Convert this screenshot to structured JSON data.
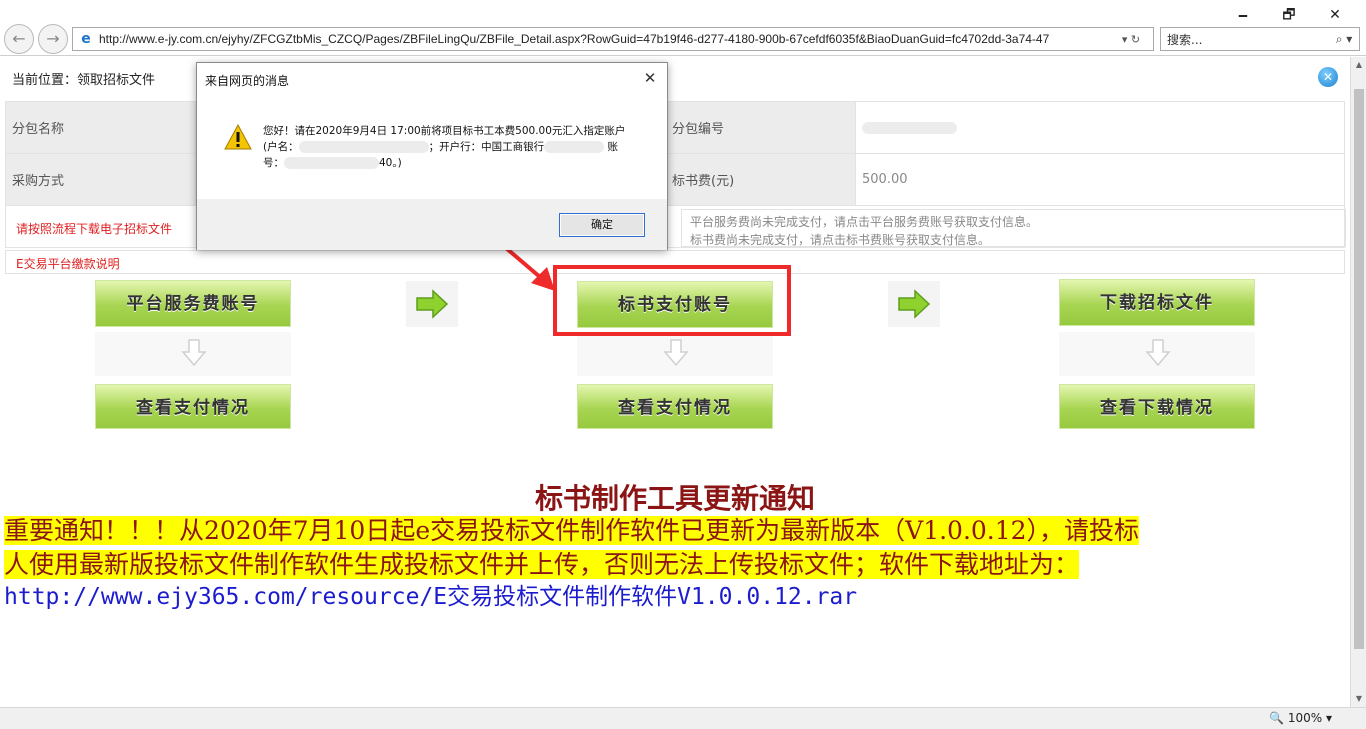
{
  "browser": {
    "window_controls": [
      "🗕",
      "🗗",
      "✕"
    ],
    "back_icon": "back-arrow-icon",
    "forward_icon": "forward-arrow-icon",
    "address": "http://www.e-jy.com.cn/ejyhy/ZFCGZtbMis_CZCQ/Pages/ZBFileLingQu/ZBFile_Detail.aspx?RowGuid=47b19f46-d277-4180-900b-67cefdf6035f&BiaoDuanGuid=fc4702dd-3a74-47",
    "address_controls": "▾ ↻",
    "search_placeholder": "搜索...",
    "search_icon": "⌕ ▾"
  },
  "page": {
    "breadcrumb": "当前位置：领取招标文件",
    "close_glyph": "✕",
    "fields": {
      "package_name_label": "分包名称",
      "package_no_label": "分包编号",
      "purchase_method_label": "采购方式",
      "doc_fee_label": "标书费(元)",
      "doc_fee_value": "500.00"
    },
    "notice_left": "请按照流程下载电子招标文件",
    "notice_right_1": "平台服务费尚未完成支付，请点击平台服务费账号获取支付信息。",
    "notice_right_2": "标书费尚未完成支付，请点击标书费账号获取支付信息。",
    "payment_note": "E交易平台缴款说明",
    "buttons": {
      "platform_fee_account": "平台服务费账号",
      "doc_pay_account": "标书支付账号",
      "download_doc": "下载招标文件",
      "view_payment_1": "查看支付情况",
      "view_payment_2": "查看支付情况",
      "view_download": "查看下载情况"
    },
    "update": {
      "title": "标书制作工具更新通知",
      "body_line1": "重要通知！！！从2020年7月10日起e交易投标文件制作软件已更新为最新版本（V1.0.0.12），请投标",
      "body_line2": "人使用最新版投标文件制作软件生成投标文件并上传，否则无法上传投标文件；软件下载地址为：",
      "link": "http://www.ejy365.com/resource/E交易投标文件制作软件V1.0.0.12.rar"
    }
  },
  "dialog": {
    "title": "来自网页的消息",
    "close_glyph": "✕",
    "message_part1": "您好！请在2020年9月4日 17:00前将项目标书工本费500.00元汇入指定账户",
    "message_part2": "(户名：",
    "message_part3": "；开户行：中国工商银行",
    "message_part4": "账",
    "message_part5": "号：",
    "message_part6": "40。)",
    "ok_label": "确定"
  },
  "status": {
    "zoom": "100%",
    "zoom_prefix": "🔍",
    "zoom_menu": "▾"
  },
  "colors": {
    "annotation_red": "#ee2a2a",
    "button_green": "#a7d552",
    "notice_red": "#e02020",
    "highlight_yellow": "#ffff00",
    "link_blue": "#1c1ccf"
  }
}
